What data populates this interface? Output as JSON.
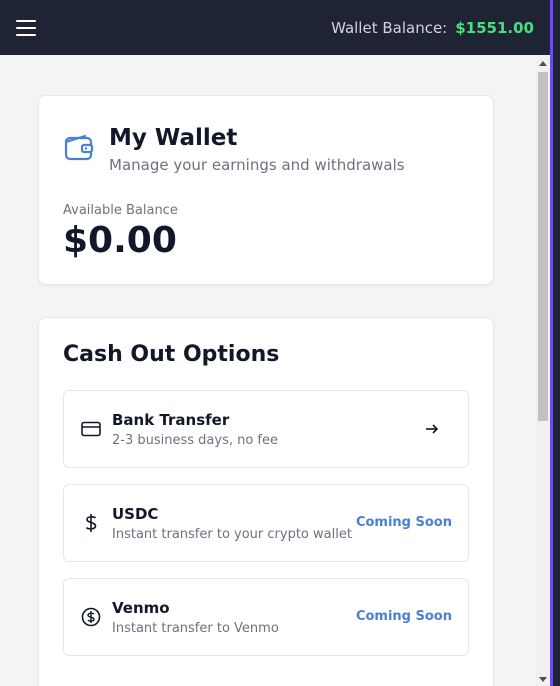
{
  "header": {
    "balance_label": "Wallet Balance:",
    "balance_amount": "$1551.00"
  },
  "wallet": {
    "title": "My Wallet",
    "subtitle": "Manage your earnings and withdrawals",
    "available_label": "Available Balance",
    "available_value": "$0.00"
  },
  "cashout": {
    "title": "Cash Out Options",
    "options": [
      {
        "name": "Bank Transfer",
        "desc": "2-3 business days, no fee",
        "icon": "credit-card-icon",
        "status": ""
      },
      {
        "name": "USDC",
        "desc": "Instant transfer to your crypto wallet",
        "icon": "dollar-icon",
        "status": "Coming Soon"
      },
      {
        "name": "Venmo",
        "desc": "Instant transfer to Venmo",
        "icon": "dollar-circle-icon",
        "status": "Coming Soon"
      }
    ]
  },
  "colors": {
    "topbar": "#1e2433",
    "balance_green": "#4ade80",
    "accent_blue": "#4a7fd6"
  }
}
